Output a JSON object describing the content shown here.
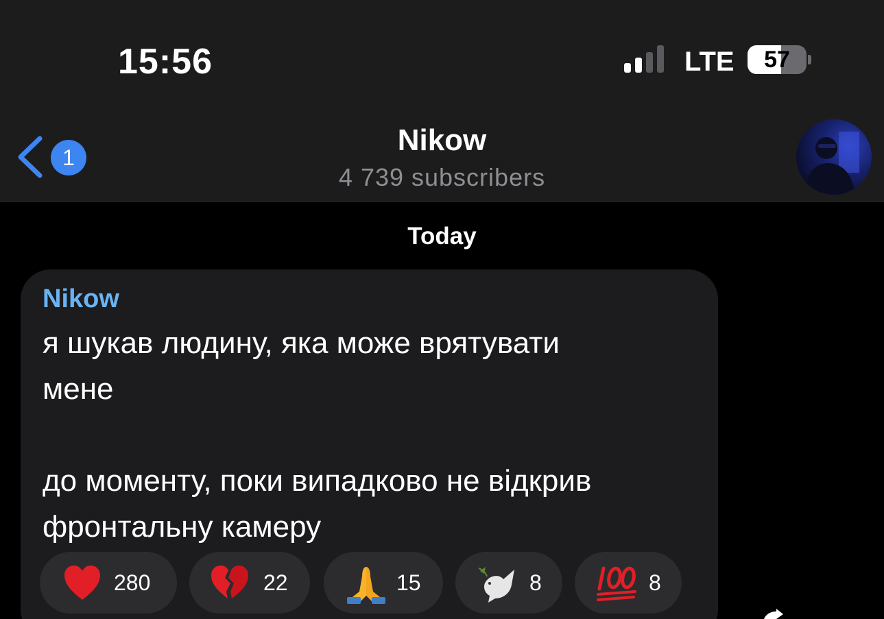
{
  "status_bar": {
    "time": "15:56",
    "network": "LTE",
    "battery": "57",
    "battery_level": 0.57
  },
  "nav": {
    "back_badge": "1",
    "title": "Nikow",
    "subtitle": "4 739 subscribers"
  },
  "chat": {
    "date_separator": "Today",
    "message": {
      "author": "Nikow",
      "lines": [
        "я шукав людину, яка може врятувати",
        "мене",
        "",
        "до моменту, поки випадково не відкрив",
        "фронтальну камеру"
      ],
      "reactions": [
        {
          "emoji": "heart-icon",
          "count": "280"
        },
        {
          "emoji": "broken-heart-icon",
          "count": "22"
        },
        {
          "emoji": "folded-hands-icon",
          "count": "15"
        },
        {
          "emoji": "dove-icon",
          "count": "8"
        },
        {
          "emoji": "hundred-points-icon",
          "count": "8"
        }
      ]
    }
  },
  "colors": {
    "header_bg": "#1c1c1d",
    "bubble_bg": "#1c1c1e",
    "reaction_bg": "#2c2c2e",
    "author": "#6ab3f3",
    "accent_blue": "#3d85f0",
    "subtitle": "#8e8e93"
  }
}
